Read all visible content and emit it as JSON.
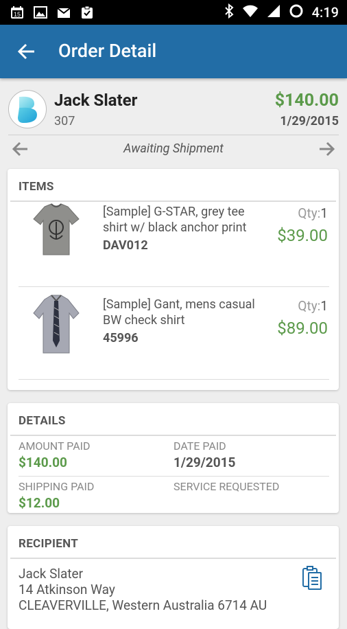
{
  "status_bar": {
    "time": "4:19",
    "calendar_badge": "15"
  },
  "app_bar": {
    "title": "Order Detail"
  },
  "order_header": {
    "customer_name": "Jack Slater",
    "customer_id": "307",
    "total": "$140.00",
    "date": "1/29/2015",
    "status": "Awaiting Shipment"
  },
  "items_section": {
    "title": "ITEMS",
    "qty_label": "Qty:",
    "items": [
      {
        "name": "[Sample] G-STAR, grey tee shirt w/ black anchor print",
        "sku": "DAV012",
        "qty": "1",
        "price": "$39.00"
      },
      {
        "name": "[Sample] Gant, mens casual BW check shirt",
        "sku": "45996",
        "qty": "1",
        "price": "$89.00"
      }
    ]
  },
  "details_section": {
    "title": "DETAILS",
    "amount_paid_label": "AMOUNT PAID",
    "amount_paid": "$140.00",
    "date_paid_label": "DATE PAID",
    "date_paid": "1/29/2015",
    "shipping_paid_label": "SHIPPING PAID",
    "shipping_paid": "$12.00",
    "service_requested_label": "SERVICE REQUESTED"
  },
  "recipient_section": {
    "title": "RECIPIENT",
    "name": "Jack Slater",
    "street": "14 Atkinson Way",
    "city_line": "CLEAVERVILLE, Western Australia 6714 AU"
  },
  "colors": {
    "app_bar": "#226da6",
    "money_green": "#5b9a4a",
    "background": "#eeeeee"
  }
}
